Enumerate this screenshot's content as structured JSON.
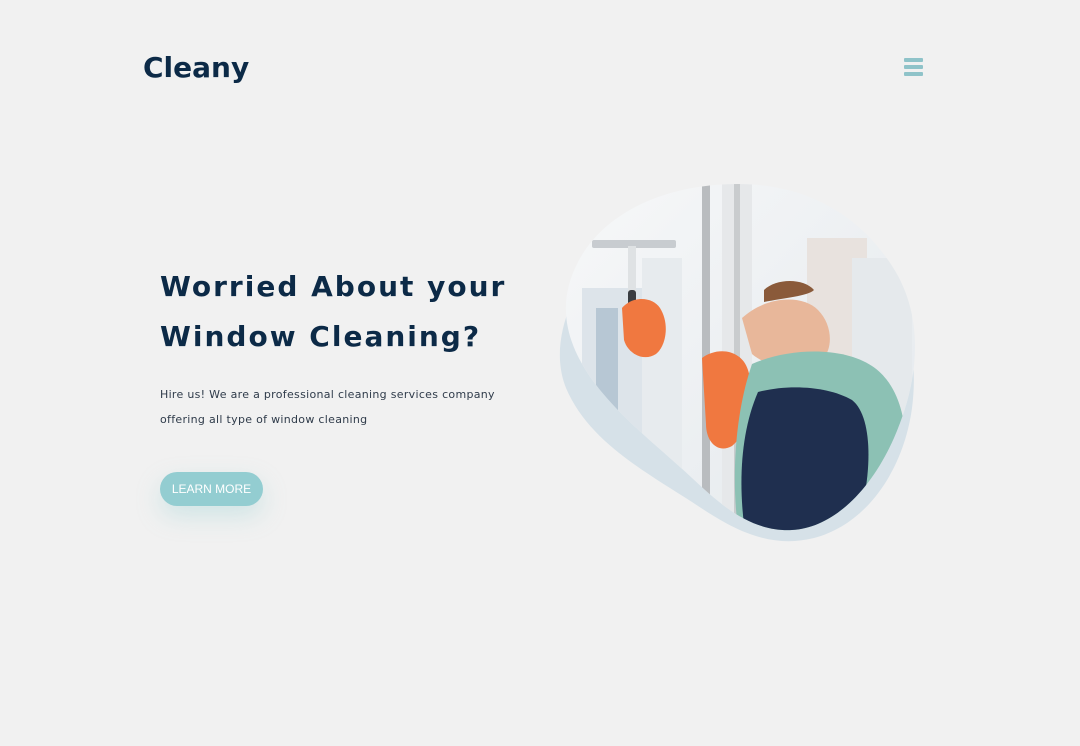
{
  "header": {
    "logo_text": "Cleany",
    "menu_icon": "hamburger-menu-icon",
    "menu_color": "#8fc3c9"
  },
  "hero": {
    "title_line1": "Worried About your",
    "title_line2": "Window Cleaning?",
    "description_line1": "Hire us! We are a professional cleaning services company",
    "description_line2": "offering all type of window cleaning",
    "cta_label": "LEARN MORE",
    "image_subject": "window-cleaner-photo"
  },
  "colors": {
    "background": "#f1f1f1",
    "heading": "#0c2a47",
    "accent": "#93cdd1",
    "blob_shadow": "#d6e1e8"
  }
}
